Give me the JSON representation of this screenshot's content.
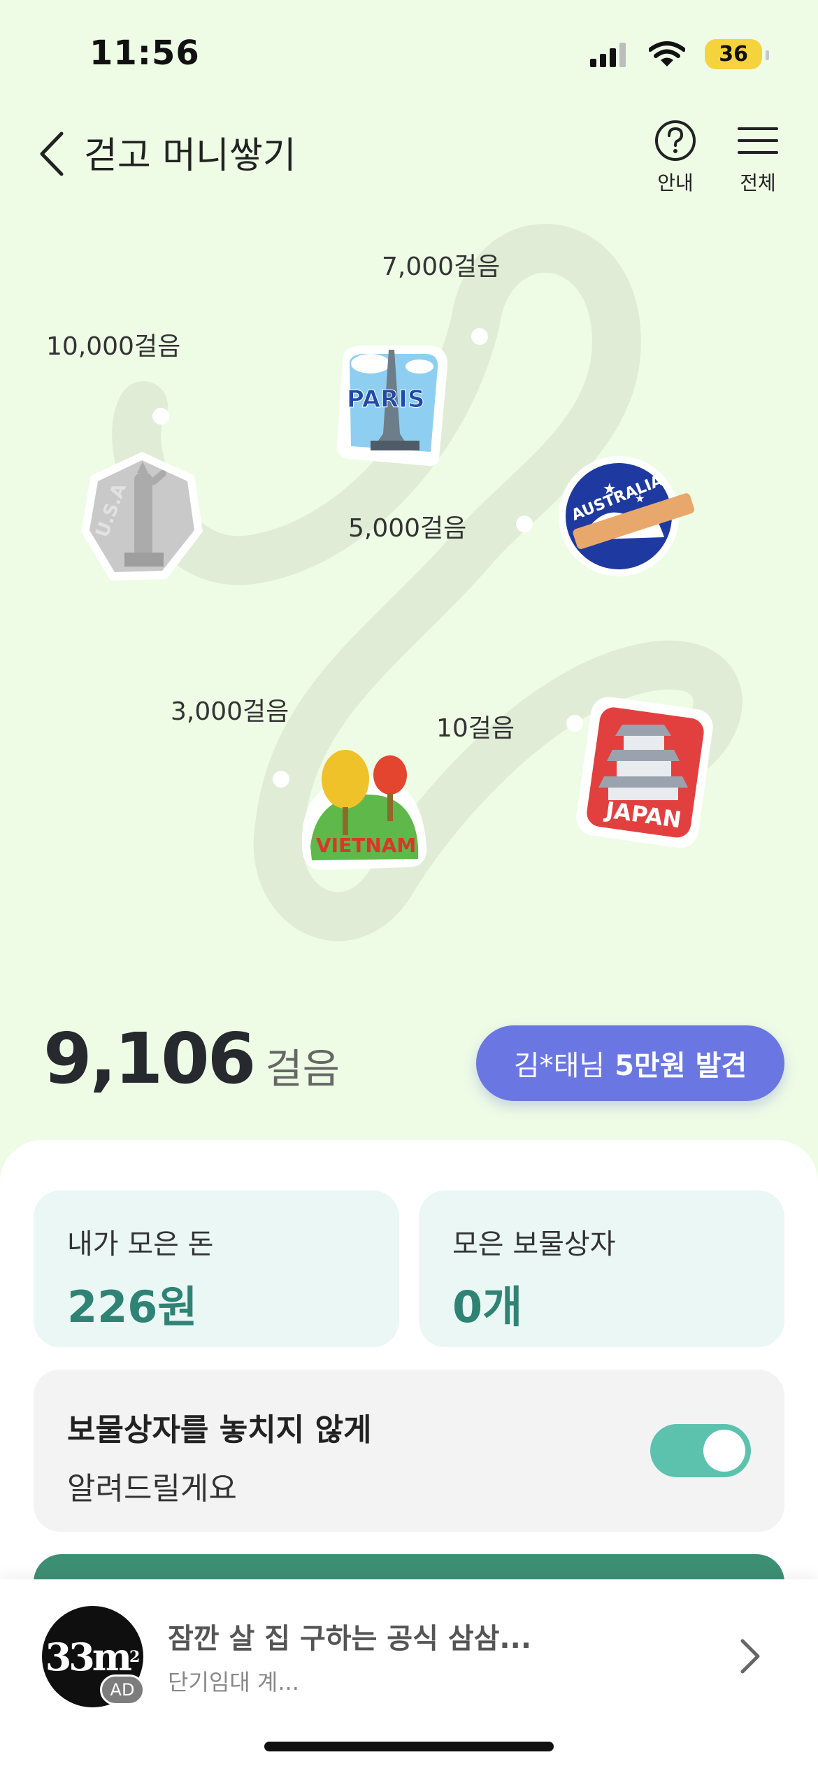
{
  "status": {
    "time": "11:56",
    "battery": "36"
  },
  "nav": {
    "title": "걷고 머니쌓기",
    "guide_label": "안내",
    "menu_label": "전체"
  },
  "map": {
    "milestones": [
      {
        "label": "10걸음",
        "sticker": "JAPAN"
      },
      {
        "label": "3,000걸음",
        "sticker": "VIETNAM"
      },
      {
        "label": "5,000걸음",
        "sticker": "AUSTRALIA"
      },
      {
        "label": "7,000걸음",
        "sticker": "PARIS"
      },
      {
        "label": "10,000걸음",
        "sticker": "U.S.A"
      }
    ]
  },
  "steps": {
    "count": "9,106",
    "unit": "걸음"
  },
  "found_banner": {
    "name": "김*태님",
    "amount": "5만원 발견"
  },
  "stats": {
    "money_label": "내가 모은 돈",
    "money_value": "226원",
    "box_label": "모은 보물상자",
    "box_value": "0개"
  },
  "notify": {
    "title": "보물상자를 놓치지 않게",
    "subtitle": "알려드릴게요",
    "enabled": true
  },
  "ad": {
    "logo": "33m",
    "logo_sup": "2",
    "badge": "AD",
    "title": "잠깐 살 집 구하는 공식 삼삼...",
    "subtitle": "단기임대 계..."
  },
  "colors": {
    "background": "#eefce6",
    "accent": "#6a77e3",
    "teal": "#2f8375",
    "toggle": "#5cc2ae"
  }
}
